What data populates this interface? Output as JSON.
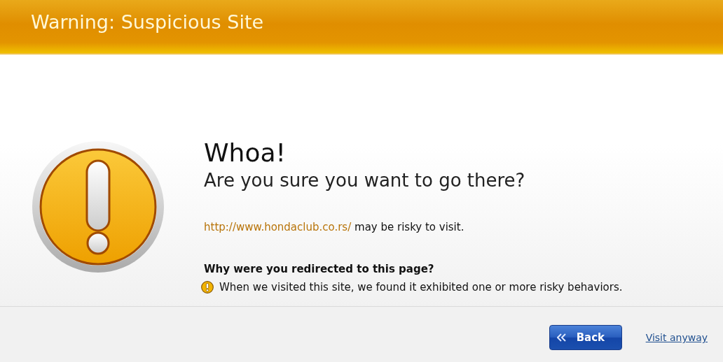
{
  "header": {
    "title": "Warning: Suspicious Site"
  },
  "heading": "Whoa!",
  "subheading": "Are you sure you want to go there?",
  "site": {
    "url": "http://www.hondaclub.co.rs/",
    "text": "may be risky to visit."
  },
  "reason": {
    "title": "Why were you redirected to this page?",
    "text": "When we visited this site, we found it exhibited one or more risky behaviors."
  },
  "buttons": [
    {
      "kind": "primary",
      "label": "Back"
    },
    {
      "kind": "link",
      "label": "Visit anyway"
    }
  ]
}
